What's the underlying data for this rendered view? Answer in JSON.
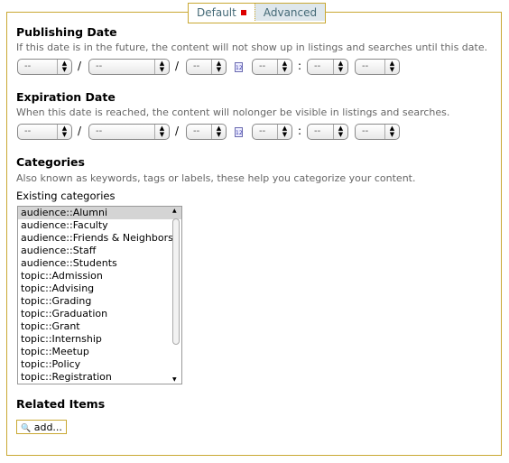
{
  "tabs": [
    {
      "label": "Default",
      "active": true
    },
    {
      "label": "Advanced"
    }
  ],
  "publishing": {
    "title": "Publishing Date",
    "desc": "If this date is in the future, the content will not show up in listings and searches until this date."
  },
  "expiration": {
    "title": "Expiration Date",
    "desc": "When this date is reached, the content will nolonger be visible in listings and searches."
  },
  "date_select_value": "--",
  "date_sep": "/",
  "time_sep": ":",
  "calendar_icon": "12",
  "categories": {
    "title": "Categories",
    "desc": "Also known as keywords, tags or labels, these help you categorize your content.",
    "existing_label": "Existing categories",
    "items": [
      "audience::Alumni",
      "audience::Faculty",
      "audience::Friends & Neighbors",
      "audience::Staff",
      "audience::Students",
      "topic::Admission",
      "topic::Advising",
      "topic::Grading",
      "topic::Graduation",
      "topic::Grant",
      "topic::Internship",
      "topic::Meetup",
      "topic::Policy",
      "topic::Registration"
    ],
    "selected": "audience::Alumni"
  },
  "related": {
    "title": "Related Items",
    "add_label": "add..."
  },
  "colors": {
    "border": "#c9a833",
    "tab_active_bg": "#dee7ec",
    "required_marker": "#dd0000"
  }
}
